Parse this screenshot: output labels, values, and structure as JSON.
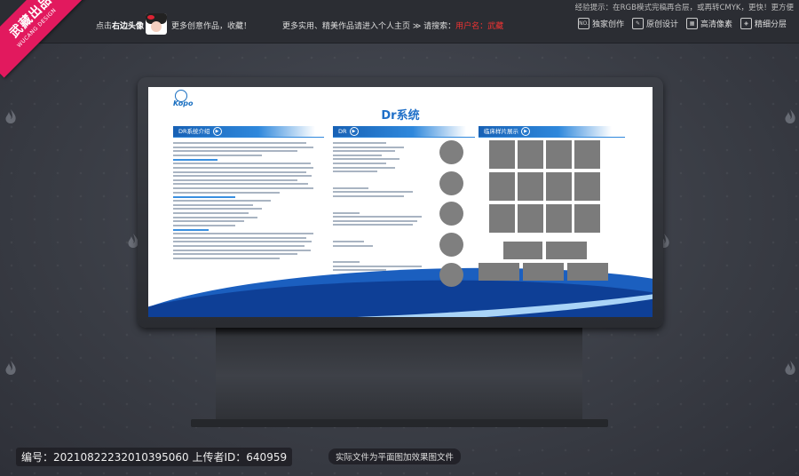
{
  "topbar": {
    "hint": "经验提示：在RGB模式完稿再合层，或再转CMYK，更快！更方便",
    "click_avatar_prefix": "点击",
    "click_avatar_bold": "右边头像",
    "more_works": "更多创意作品，收藏！",
    "promo_text": "更多实用、精美作品请进入个人主页 ≫ 请搜索：",
    "promo_user": "用户名：武藏",
    "badges": [
      {
        "icon": "NO.",
        "label": "独家创作"
      },
      {
        "icon": "✎",
        "label": "原创设计"
      },
      {
        "icon": "▦",
        "label": "高清像素"
      },
      {
        "icon": "◈",
        "label": "精细分层"
      }
    ]
  },
  "ribbon": {
    "title": "武藏出品",
    "subtitle": "WUCANG DESIGN"
  },
  "board": {
    "brand": "Kopo",
    "title": "Dr系统",
    "col1_head": "DR系统介绍",
    "col2_head": "DR",
    "col3_head": "临床样片展示"
  },
  "footer": {
    "code": "编号：20210822232010395060 上传者ID：640959",
    "note": "实际文件为平面图加效果图文件"
  },
  "colors": {
    "accent": "#1f6fc8",
    "ribbon": "#e2195e",
    "wave": "#1b5fbf"
  }
}
